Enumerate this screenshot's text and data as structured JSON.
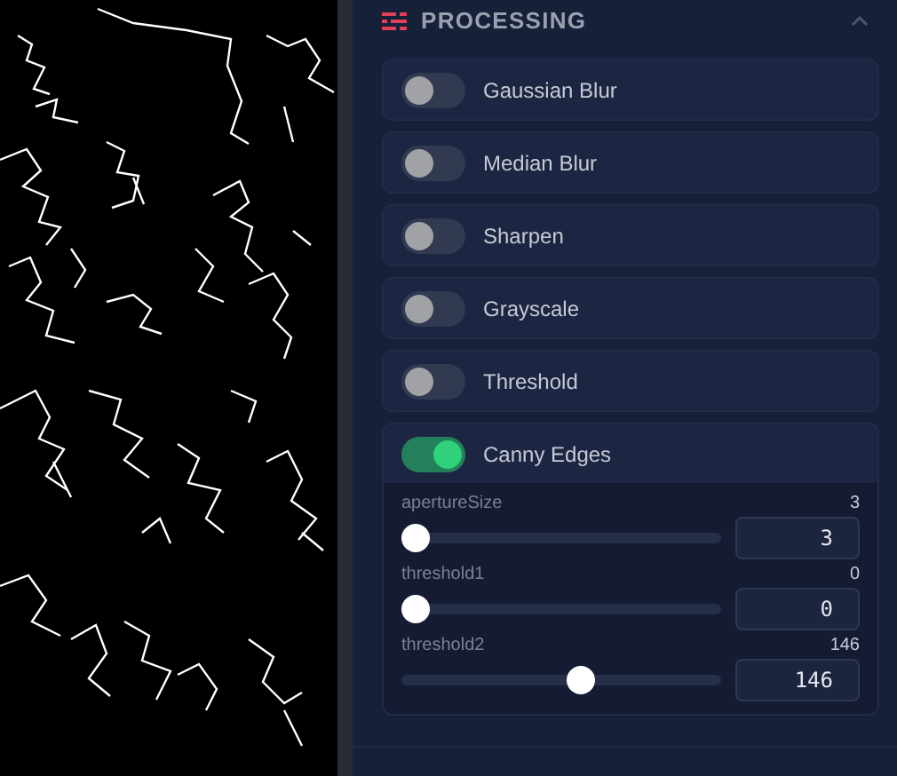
{
  "section": {
    "title": "PROCESSING",
    "expanded": true
  },
  "filters": [
    {
      "label": "Gaussian Blur",
      "on": false
    },
    {
      "label": "Median Blur",
      "on": false
    },
    {
      "label": "Sharpen",
      "on": false
    },
    {
      "label": "Grayscale",
      "on": false
    },
    {
      "label": "Threshold",
      "on": false
    },
    {
      "label": "Canny Edges",
      "on": true,
      "params": [
        {
          "name": "apertureSize",
          "reading": "3",
          "value": "3",
          "level": 0
        },
        {
          "name": "threshold1",
          "reading": "0",
          "value": "0",
          "level": 0
        },
        {
          "name": "threshold2",
          "reading": "146",
          "value": "146",
          "level": 0.57
        }
      ]
    }
  ]
}
